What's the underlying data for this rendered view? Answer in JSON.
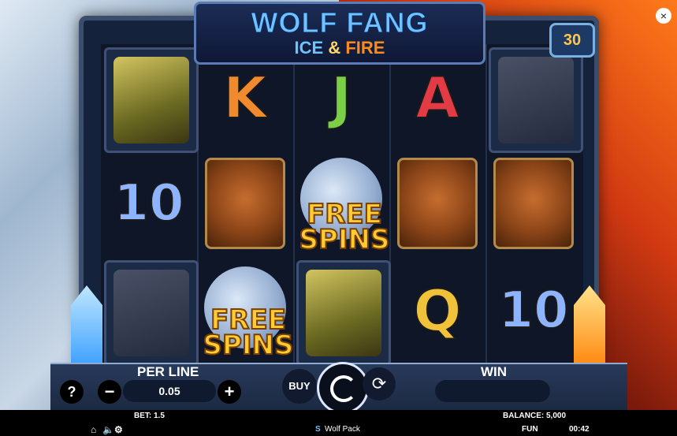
{
  "logo": {
    "line1": "WOLF FANG",
    "ice": "ICE",
    "amp": "&",
    "fire": "FIRE"
  },
  "lines_badge": "30",
  "close_label": "×",
  "reels": [
    [
      "hawk",
      "10",
      "deer"
    ],
    [
      "K",
      "bear",
      "free_spins"
    ],
    [
      "J",
      "free_spins",
      "hawk"
    ],
    [
      "A",
      "bear",
      "Q"
    ],
    [
      "deer",
      "bear",
      "10"
    ]
  ],
  "symbols": {
    "ten": "10",
    "K": "K",
    "J": "J",
    "A": "A",
    "Q": "Q",
    "free_line1": "FREE",
    "free_line2": "SPINS"
  },
  "controls": {
    "help": "?",
    "minus": "−",
    "plus": "+",
    "per_line_label": "PER LINE",
    "per_line_value": "0.05",
    "buy": "BUY",
    "win_label": "WIN"
  },
  "status": {
    "bet": "BET: 1.5",
    "balance": "BALANCE: 5,000",
    "game_name": "Wolf Pack",
    "mode": "FUN",
    "time": "00:42"
  },
  "colors": {
    "accent_ice": "#6ec3ff",
    "accent_fire": "#ff8a1c",
    "gold": "#ffcc33"
  }
}
